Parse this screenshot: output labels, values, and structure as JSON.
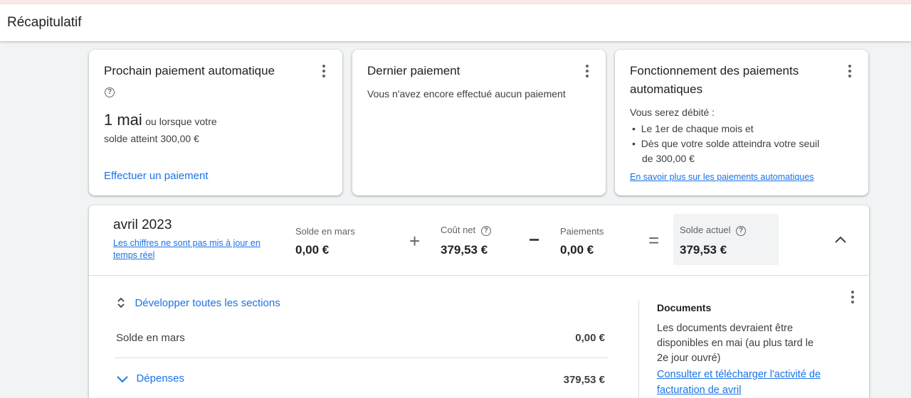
{
  "header": {
    "title": "Récapitulatif"
  },
  "card_next": {
    "title": "Prochain paiement automatique",
    "date": "1 mai",
    "date_suffix": "ou lorsque votre",
    "threshold": "solde atteint 300,00 €",
    "action": "Effectuer un paiement"
  },
  "card_last": {
    "title": "Dernier paiement",
    "text": "Vous n'avez encore effectué aucun paiement"
  },
  "card_how": {
    "title_line1": "Fonctionnement des paiements",
    "title_line2": "automatiques",
    "intro": "Vous serez débité :",
    "bullet1": "Le 1er de chaque mois et",
    "bullet2_line1": "Dès que votre solde atteindra votre seuil",
    "bullet2_line2": "de 300,00 €",
    "link": "En savoir plus sur les paiements automatiques"
  },
  "summary": {
    "month": "avril 2023",
    "notice_line1": "Les chiffres ne sont pas mis à jour en",
    "notice_line2": "temps réel",
    "prev_label": "Solde en mars",
    "prev_value": "0,00 €",
    "net_label": "Coût net",
    "net_value": "379,53 €",
    "pay_label": "Paiements",
    "pay_value": "0,00 €",
    "current_label": "Solde actuel",
    "current_value": "379,53 €",
    "plus": "+",
    "minus": "−",
    "equals": "="
  },
  "details": {
    "expand_all": "Développer toutes les sections",
    "rows": [
      {
        "label": "Solde en mars",
        "value": "0,00 €"
      },
      {
        "label": "Dépenses",
        "value": "379,53 €"
      }
    ]
  },
  "documents": {
    "title": "Documents",
    "text_line1": "Les documents devraient être",
    "text_line2": "disponibles en mai (au plus tard le",
    "text_line3": "2e jour ouvré)",
    "link_line1": "Consulter et télécharger l'activité de",
    "link_line2": "facturation de avril"
  }
}
